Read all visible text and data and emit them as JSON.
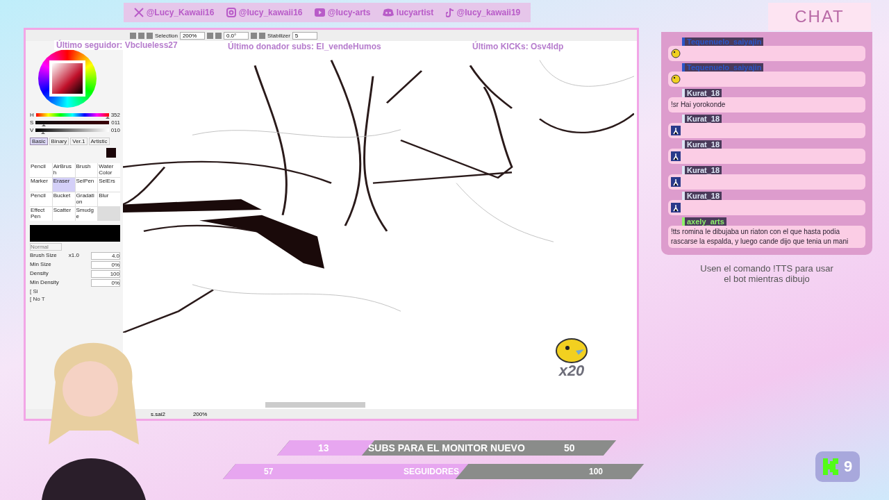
{
  "socials": [
    {
      "kind": "x",
      "handle": "@Lucy_Kawaii16"
    },
    {
      "kind": "instagram",
      "handle": "@lucy_kawaii16"
    },
    {
      "kind": "youtube",
      "handle": "@lucy-arts"
    },
    {
      "kind": "discord",
      "handle": "lucyartist"
    },
    {
      "kind": "tiktok",
      "handle": "@lucy_kawaii19"
    }
  ],
  "toolbar": {
    "selection_label": "Selection",
    "zoom": "200%",
    "angle": "0.0°",
    "stabilizer_label": "Stabilizer",
    "stabilizer": "5"
  },
  "color_sliders": [
    {
      "label": "H",
      "value": "352",
      "level": 0.98
    },
    {
      "label": "S",
      "value": "011",
      "level": 0.11
    },
    {
      "label": "V",
      "value": "010",
      "level": 0.1
    }
  ],
  "tool_tabs": [
    {
      "label": "Basic",
      "selected": true
    },
    {
      "label": "Binary",
      "selected": false
    },
    {
      "label": "Ver.1",
      "selected": false
    },
    {
      "label": "Artistic",
      "selected": false
    }
  ],
  "brushes": [
    {
      "label": "Pencil",
      "selected": false
    },
    {
      "label": "AirBrush",
      "selected": false
    },
    {
      "label": "Brush",
      "selected": false
    },
    {
      "label": "Water Color",
      "selected": false
    },
    {
      "label": "Marker",
      "selected": false
    },
    {
      "label": "Eraser",
      "selected": true
    },
    {
      "label": "SelPen",
      "selected": false
    },
    {
      "label": "SelErs",
      "selected": false
    },
    {
      "label": "Pencil",
      "selected": false
    },
    {
      "label": "Bucket",
      "selected": false
    },
    {
      "label": "Gradation",
      "selected": false
    },
    {
      "label": "Blur",
      "selected": false
    },
    {
      "label": "Effect Pen",
      "selected": false
    },
    {
      "label": "Scatter",
      "selected": false
    },
    {
      "label": "Smudge",
      "selected": false
    }
  ],
  "brush_settings": {
    "blend_mode": "Normal",
    "rows": [
      {
        "label": "Brush Size",
        "multiplier": "x1.0",
        "value": "4.0"
      },
      {
        "label": "Min Size",
        "value": "0%"
      },
      {
        "label": "Density",
        "value": "100"
      },
      {
        "label": "Min Density",
        "value": "0%"
      }
    ],
    "shapes": [
      "[ Si",
      "[ No T"
    ]
  },
  "overlays": {
    "last_follower": "Último seguidor: Vbclueless27",
    "last_donor": "Último donador subs: El_vendeHumos",
    "last_kicks": "Último KICKs: Osv4ldp"
  },
  "status": {
    "file": "s.sai2",
    "zoom": "200%"
  },
  "chat": {
    "title": "CHAT",
    "messages": [
      {
        "user": "Tequenuelo_saiyajin",
        "color": "#2b55c8",
        "kind": "pac-emote"
      },
      {
        "user": "Tequenuelo_saiyajin",
        "color": "#2b55c8",
        "kind": "pac-emote"
      },
      {
        "user": "Kurat_18",
        "color": "#dde6f5",
        "kind": "text",
        "text": "!sr Hai yorokonde"
      },
      {
        "user": "Kurat_18",
        "color": "#dde6f5",
        "kind": "sprite-emote"
      },
      {
        "user": "Kurat_18",
        "color": "#dde6f5",
        "kind": "sprite-emote"
      },
      {
        "user": "Kurat_18",
        "color": "#dde6f5",
        "kind": "sprite-emote"
      },
      {
        "user": "Kurat_18",
        "color": "#dde6f5",
        "kind": "sprite-emote"
      },
      {
        "user": "axely_arts",
        "color": "#8ef06a",
        "kind": "text",
        "text": "!tts romina le dibujaba un riaton con el que hasta podia rascarse la espalda, y luego cande dijo que tenia un mani"
      }
    ],
    "footer": "Usen el comando !TTS para usar el bot mientras dibujo"
  },
  "emote_combo": {
    "count": "x20"
  },
  "goals": [
    {
      "start": "13",
      "label": "SUBS PARA EL MONITOR NUEVO",
      "end": "50",
      "level": 0.26
    },
    {
      "start": "57",
      "label": "SEGUIDORES",
      "end": "100",
      "level": 0.57
    }
  ],
  "kick_badge": {
    "count": "9"
  }
}
